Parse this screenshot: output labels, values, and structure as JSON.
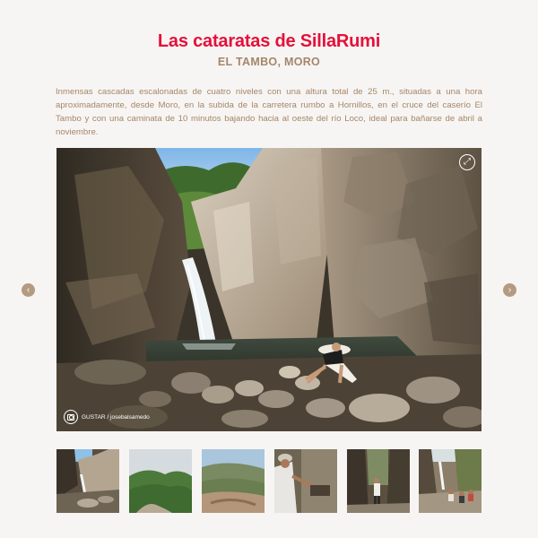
{
  "header": {
    "title": "Las cataratas de SillaRumi",
    "subtitle": "EL TAMBO, MORO"
  },
  "description": "Inmensas cascadas escalonadas de cuatro niveles con una altura total de 25 m., situadas a una hora aproximadamente, desde Moro, en la subida de la carretera rumbo a Hornillos, en el cruce del caserío El Tambo y con una caminata de 10 minutos bajando hacia al oeste del río Loco, ideal para bañarse de abril a noviembre.",
  "viewer": {
    "credit": "GUSTAR / josebalsamedo",
    "expand_icon": "expand-icon",
    "prev_icon": "chevron-left-icon",
    "next_icon": "chevron-right-icon"
  },
  "thumbnails": [
    {
      "subject": "waterfall-rocks"
    },
    {
      "subject": "green-mountains-road"
    },
    {
      "subject": "valley-mountains"
    },
    {
      "subject": "person-with-hat"
    },
    {
      "subject": "person-in-canyon"
    },
    {
      "subject": "group-at-waterfall"
    }
  ],
  "colors": {
    "title": "#e5103a",
    "accent": "#a4866a",
    "nav_button": "#b59a82"
  }
}
